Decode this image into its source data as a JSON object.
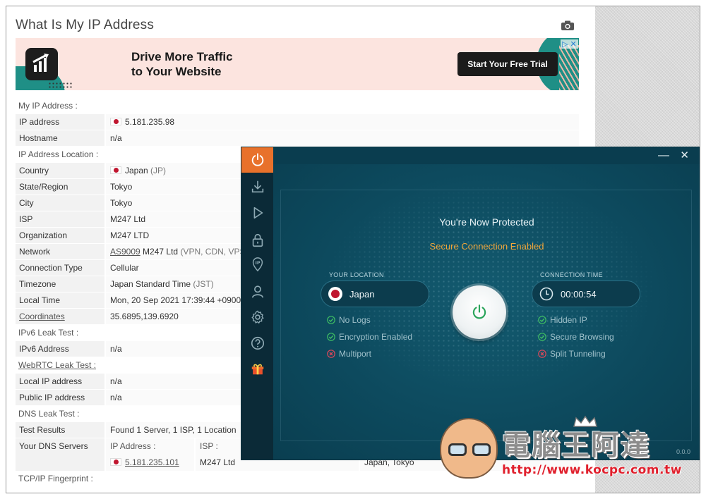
{
  "page": {
    "title": "What Is My IP Address",
    "camera_icon": "camera-icon"
  },
  "ad": {
    "headline_1": "Drive More Traffic",
    "headline_2": "to Your Website",
    "cta": "Start Your Free Trial",
    "adchoice": "▷ ✕"
  },
  "sections": {
    "my_ip": "My IP Address :",
    "location": "IP Address Location :",
    "ipv6": "IPv6 Leak Test :",
    "webrtc": "WebRTC Leak Test :",
    "dns": "DNS Leak Test :",
    "tcpip": "TCP/IP Fingerprint :"
  },
  "rows": {
    "ip_label": "IP address",
    "ip_value": "5.181.235.98",
    "hostname_label": "Hostname",
    "hostname_value": "n/a",
    "country_label": "Country",
    "country_value": "Japan",
    "country_code": "(JP)",
    "state_label": "State/Region",
    "state_value": "Tokyo",
    "city_label": "City",
    "city_value": "Tokyo",
    "isp_label": "ISP",
    "isp_value": "M247 Ltd",
    "org_label": "Organization",
    "org_value": "M247 LTD",
    "network_label": "Network",
    "network_asn": "AS9009",
    "network_value": "M247 Ltd",
    "network_sub": "(VPN, CDN, VPSH",
    "conn_label": "Connection Type",
    "conn_value": "Cellular",
    "tz_label": "Timezone",
    "tz_value": "Japan Standard Time",
    "tz_sub": "(JST)",
    "local_time_label": "Local Time",
    "local_time_value": "Mon, 20 Sep 2021 17:39:44 +0900",
    "coords_label": "Coordinates",
    "coords_value": "35.6895,139.6920",
    "ipv6_label": "IPv6 Address",
    "ipv6_value": "n/a",
    "webrtc_local_label": "Local IP address",
    "webrtc_local_value": "n/a",
    "webrtc_public_label": "Public IP address",
    "webrtc_public_value": "n/a",
    "dns_results_label": "Test Results",
    "dns_results_value": "Found 1 Server, 1 ISP, 1 Location",
    "dns_servers_label": "Your DNS Servers",
    "dns_col_ip": "IP Address :",
    "dns_col_isp": "ISP :",
    "dns_ip": "5.181.235.101",
    "dns_isp": "M247 Ltd",
    "dns_location": "Japan, Tokyo"
  },
  "vpn": {
    "status_title": "You're Now Protected",
    "status_sub": "Secure Connection Enabled",
    "your_location_label": "YOUR LOCATION",
    "location": "Japan",
    "connection_time_label": "CONNECTION TIME",
    "connection_time": "00:00:54",
    "left_features": [
      {
        "label": "No Logs",
        "state": "on"
      },
      {
        "label": "Encryption Enabled",
        "state": "on"
      },
      {
        "label": "Multiport",
        "state": "off"
      }
    ],
    "right_features": [
      {
        "label": "Hidden IP",
        "state": "on"
      },
      {
        "label": "Secure Browsing",
        "state": "on"
      },
      {
        "label": "Split Tunneling",
        "state": "off"
      }
    ],
    "version": "0.0.0",
    "accent": "#e8712b",
    "status_color": "#f2a63a",
    "nav_icons": [
      "power-icon",
      "download-icon",
      "play-icon",
      "lock-icon",
      "ip-pin-icon",
      "user-icon",
      "gear-icon",
      "help-icon",
      "gift-icon"
    ]
  },
  "watermark": {
    "title": "電腦王阿達",
    "url": "http://www.kocpc.com.tw"
  }
}
